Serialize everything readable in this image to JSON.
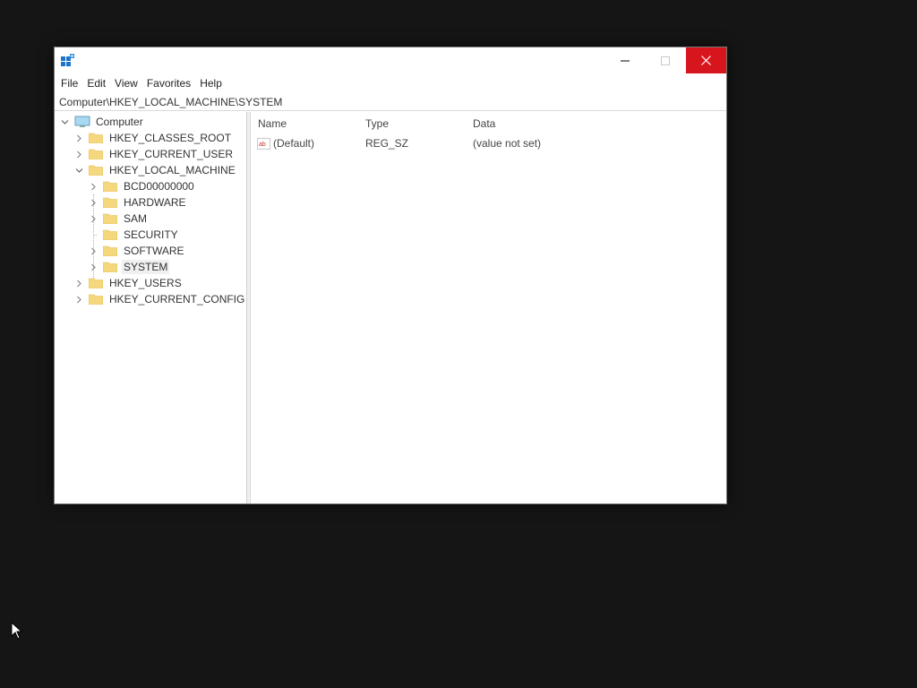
{
  "menu": [
    "File",
    "Edit",
    "View",
    "Favorites",
    "Help"
  ],
  "address": "Computer\\HKEY_LOCAL_MACHINE\\SYSTEM",
  "tree": {
    "root": "Computer",
    "hives": [
      "HKEY_CLASSES_ROOT",
      "HKEY_CURRENT_USER",
      "HKEY_LOCAL_MACHINE",
      "HKEY_USERS",
      "HKEY_CURRENT_CONFIG"
    ],
    "hklm_children": [
      "BCD00000000",
      "HARDWARE",
      "SAM",
      "SECURITY",
      "SOFTWARE",
      "SYSTEM"
    ]
  },
  "list": {
    "columns": [
      "Name",
      "Type",
      "Data"
    ],
    "rows": [
      {
        "name": "(Default)",
        "type": "REG_SZ",
        "data": "(value not set)"
      }
    ]
  },
  "colors": {
    "close_button": "#d7151c",
    "folder": "#f5d77e",
    "desktop": "#151515"
  },
  "icons": {
    "app": "regedit-icon",
    "minimize": "minimize-icon",
    "maximize": "maximize-icon",
    "close": "close-icon",
    "value": "string-value-icon"
  }
}
